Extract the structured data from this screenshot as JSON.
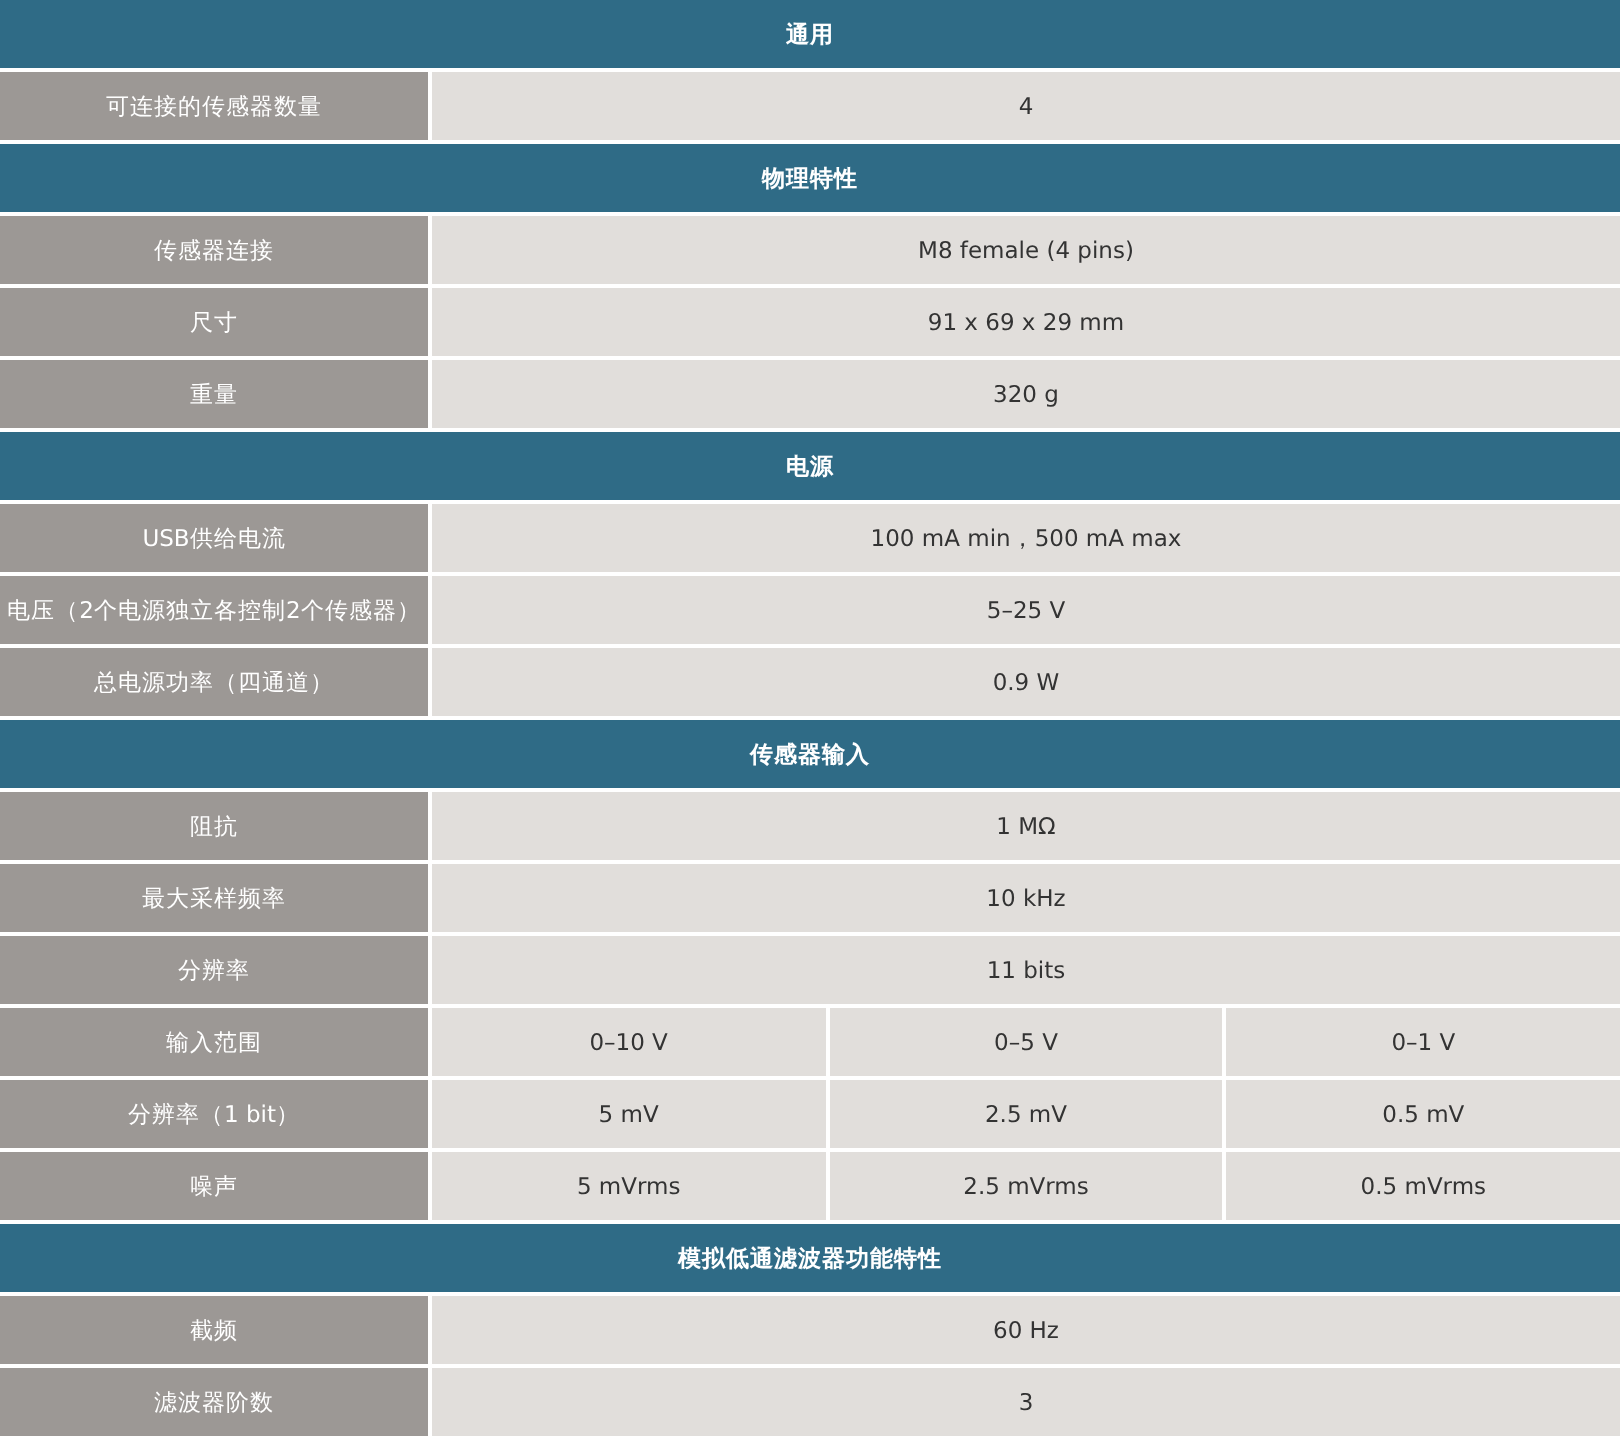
{
  "sections": [
    {
      "title": "通用",
      "rows": [
        {
          "label": "可连接的传感器数量",
          "values": [
            "4"
          ]
        }
      ]
    },
    {
      "title": "物理特性",
      "rows": [
        {
          "label": "传感器连接",
          "values": [
            "M8 female (4 pins)"
          ]
        },
        {
          "label": "尺寸",
          "values": [
            "91 x 69 x 29 mm"
          ]
        },
        {
          "label": "重量",
          "values": [
            "320 g"
          ]
        }
      ]
    },
    {
      "title": "电源",
      "rows": [
        {
          "label": "USB供给电流",
          "values": [
            "100 mA min，500 mA max"
          ]
        },
        {
          "label": "电压（2个电源独立各控制2个传感器）",
          "values": [
            "5–25 V"
          ]
        },
        {
          "label": "总电源功率（四通道）",
          "values": [
            "0.9 W"
          ]
        }
      ]
    },
    {
      "title": "传感器输入",
      "rows": [
        {
          "label": "阻抗",
          "values": [
            "1 MΩ"
          ]
        },
        {
          "label": "最大采样频率",
          "values": [
            "10 kHz"
          ]
        },
        {
          "label": "分辨率",
          "values": [
            "11 bits"
          ]
        },
        {
          "label": "输入范围",
          "values": [
            "0–10 V",
            "0–5 V",
            "0–1 V"
          ]
        },
        {
          "label": "分辨率（1 bit）",
          "values": [
            "5 mV",
            "2.5 mV",
            "0.5 mV"
          ]
        },
        {
          "label": "噪声",
          "values": [
            "5 mVrms",
            "2.5 mVrms",
            "0.5 mVrms"
          ]
        }
      ]
    },
    {
      "title": "模拟低通滤波器功能特性",
      "rows": [
        {
          "label": "截频",
          "values": [
            "60 Hz"
          ]
        },
        {
          "label": "滤波器阶数",
          "values": [
            "3"
          ]
        }
      ]
    }
  ]
}
